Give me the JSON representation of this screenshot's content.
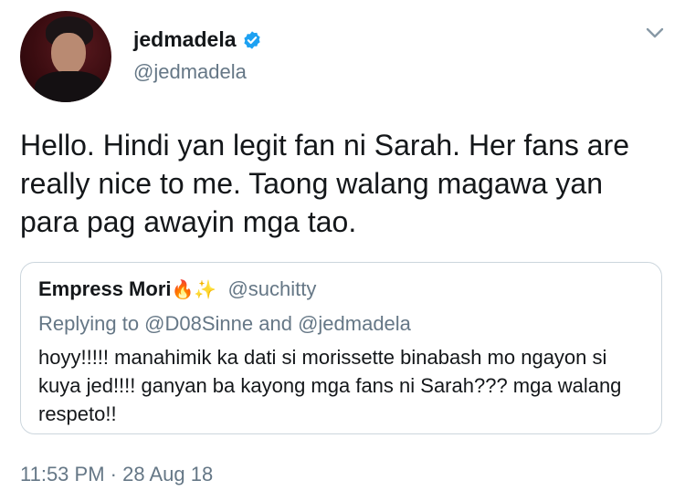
{
  "author": {
    "display_name": "jedmadela",
    "handle": "@jedmadela",
    "verified": true,
    "avatar_icon": "profile-photo",
    "verified_icon": "verified-badge-icon",
    "menu_icon": "chevron-down-icon"
  },
  "tweet": {
    "text": "Hello. Hindi yan legit fan ni Sarah. Her fans are really nice to me. Taong walang magawa yan para pag awayin mga tao.",
    "timestamp": "11:53 PM · 28 Aug 18"
  },
  "quoted_tweet": {
    "display_name": "Empress Mori",
    "emoji": "🔥✨",
    "handle": "@suchitty",
    "replying_to": "Replying to @D08Sinne and @jedmadela",
    "text": "hoyy!!!!! manahimik ka dati si morissette binabash mo ngayon si kuya jed!!!! ganyan ba kayong mga fans ni Sarah??? mga walang respeto!!"
  },
  "colors": {
    "primary_text": "#14171a",
    "secondary_text": "#657786",
    "verified_blue": "#1da1f2",
    "border": "#ccd6dd"
  }
}
